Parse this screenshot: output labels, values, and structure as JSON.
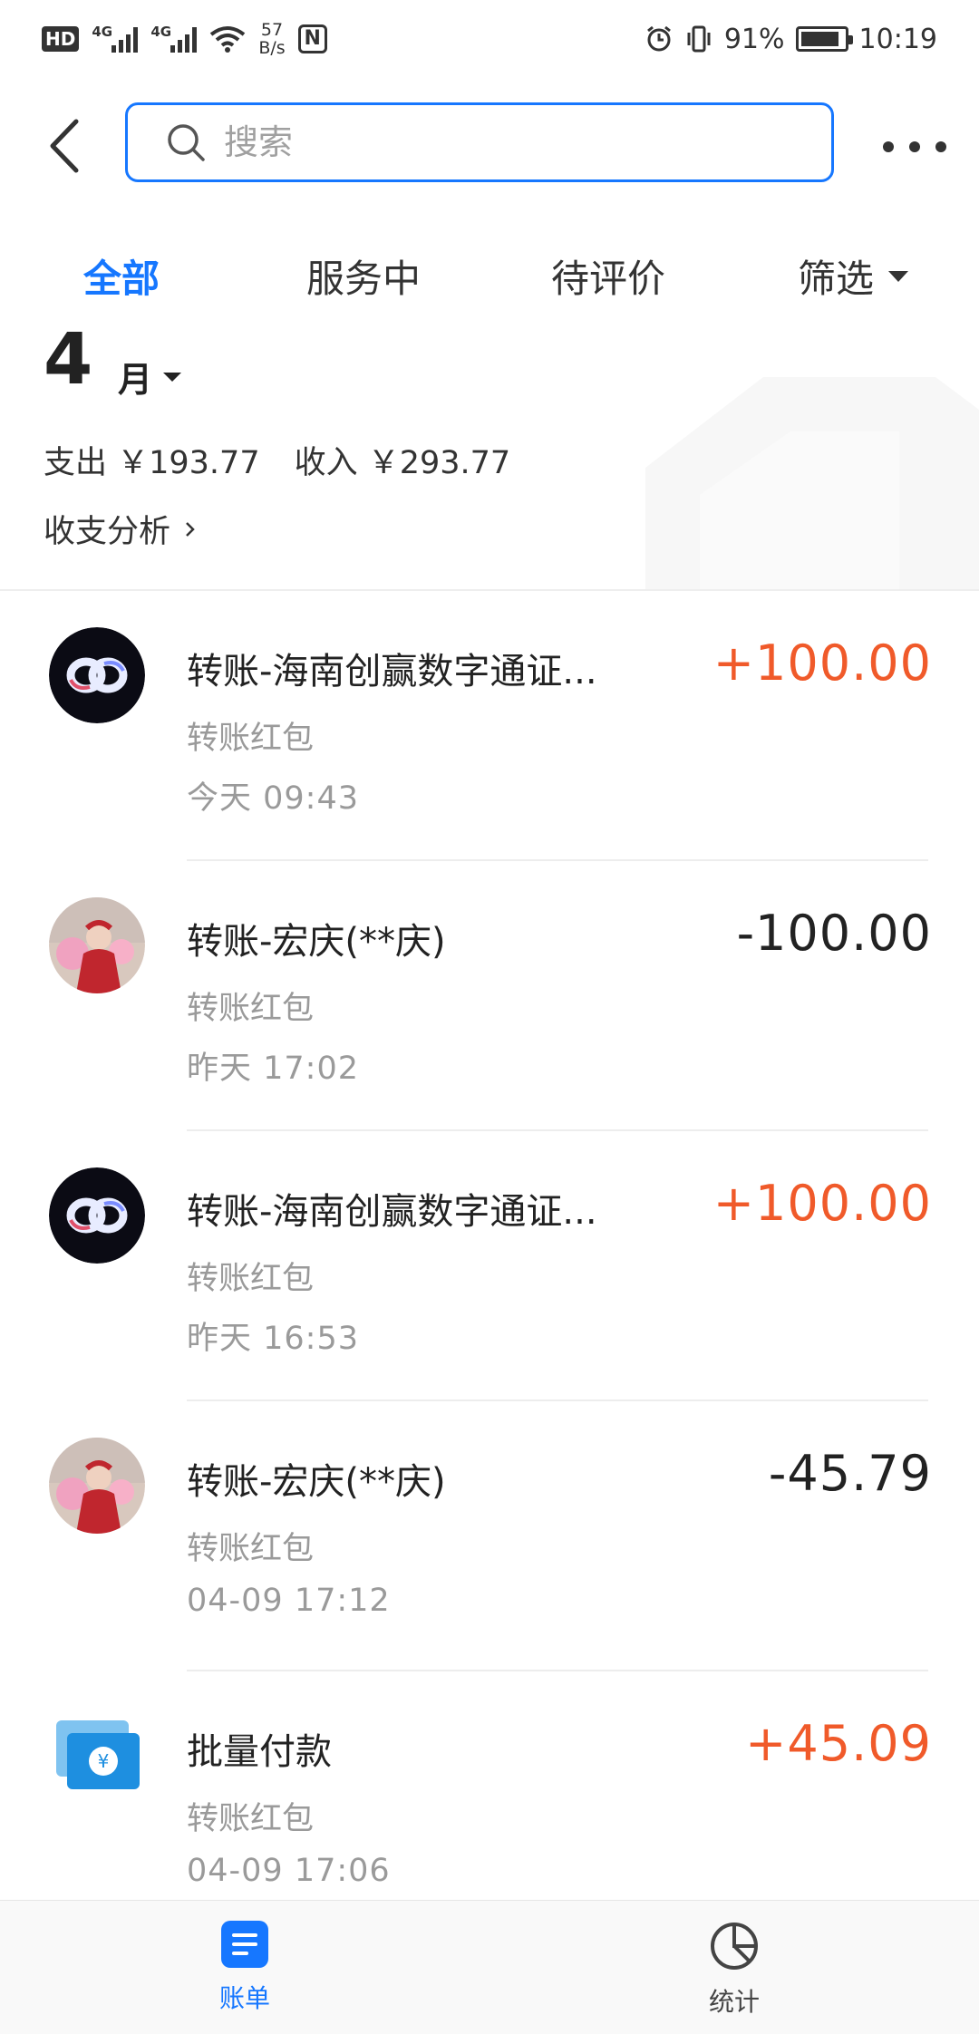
{
  "status_bar": {
    "network_left": "4G",
    "network_right": "4G",
    "speed_value": "57",
    "speed_unit": "B/s",
    "battery": "91%",
    "time": "10:19"
  },
  "header": {
    "search_placeholder": "搜索"
  },
  "tabs": [
    {
      "label": "全部"
    },
    {
      "label": "服务中"
    },
    {
      "label": "待评价"
    },
    {
      "label": "筛选"
    }
  ],
  "month": {
    "number": "4",
    "unit": "月",
    "expense": "支出 ￥193.77",
    "income": "收入 ￥293.77",
    "analysis": "收支分析"
  },
  "transactions": [
    {
      "title": "转账-海南创赢数字通证...",
      "subtitle": "转账红包",
      "time": "今天  09:43",
      "amount": "+100.00"
    },
    {
      "title": "转账-宏庆(**庆)",
      "subtitle": "转账红包",
      "time": "昨天  17:02",
      "amount": "-100.00"
    },
    {
      "title": "转账-海南创赢数字通证...",
      "subtitle": "转账红包",
      "time": "昨天  16:53",
      "amount": "+100.00"
    },
    {
      "title": "转账-宏庆(**庆)",
      "subtitle": "转账红包",
      "time": "04-09  17:12",
      "amount": "-45.79"
    },
    {
      "title": "批量付款",
      "subtitle": "转账红包",
      "time": "04-09  17:06",
      "amount": "+45.09"
    }
  ],
  "bottom_nav": [
    {
      "label": "账单"
    },
    {
      "label": "统计"
    }
  ],
  "colors": {
    "accent": "#1677ff",
    "income": "#f05a2a",
    "expense": "#222222"
  }
}
